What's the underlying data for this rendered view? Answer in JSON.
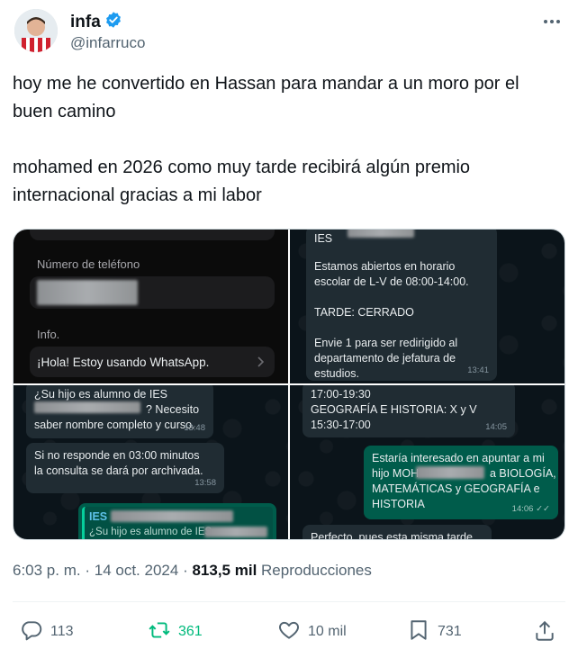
{
  "author": {
    "name": "infa",
    "handle": "@infarruco",
    "verified_badge_color": "#1d9bf0"
  },
  "tweet": {
    "paragraphs": [
      "hoy me he convertido en Hassan para mandar a un moro por el buen camino",
      "mohamed en 2026 como muy tarde recibirá algún premio internacional gracias a mi labor"
    ]
  },
  "media": {
    "panel1": {
      "phone_label": "Número de teléfono",
      "info_label": "Info.",
      "info_value": "¡Hola! Estoy usando WhatsApp."
    },
    "panel2": {
      "top_label": "IES",
      "message_lines": [
        "Estamos abiertos en horario",
        "escolar de L-V de 08:00-14:00.",
        "",
        "TARDE: CERRADO",
        "",
        "Envie 1 para ser redirigido al",
        "departamento de jefatura de",
        "estudios."
      ],
      "time": "13:41"
    },
    "panel3": {
      "bubble1_lines": [
        "¿Su hijo es alumno de IES",
        "? Necesito",
        "saber nombre completo y curso."
      ],
      "bubble1_time": "13:48",
      "bubble2_lines": [
        "Si no responde en 03:00 minutos",
        "la consulta se dará por archivada."
      ],
      "bubble2_time": "13:58",
      "quote_label": "IES",
      "quote_text": "¿Su hijo es alumno de IES"
    },
    "panel4": {
      "bubble1_lines": [
        "17:00-19:30",
        "GEOGRAFÍA E HISTORIA: X y V",
        "15:30-17:00"
      ],
      "bubble1_time": "14:05",
      "out_lines": [
        "Estaría interesado en apuntar a mi",
        "hijo MOH",
        "a BIOLOGÍA,",
        "MATEMÁTICAS y GEOGRAFÍA e",
        "HISTORIA"
      ],
      "out_time": "14:06 ✓✓",
      "bottom_text": "Perfecto, pues esta misma tarde"
    }
  },
  "meta": {
    "time": "6:03 p. m.",
    "separator": "·",
    "date": "14 oct. 2024",
    "views_count": "813,5 mil",
    "views_label": "Reproducciones"
  },
  "actions": {
    "replies": "113",
    "reposts": "361",
    "likes": "10 mil",
    "bookmarks": "731",
    "repost_color": "#00ba7c"
  }
}
